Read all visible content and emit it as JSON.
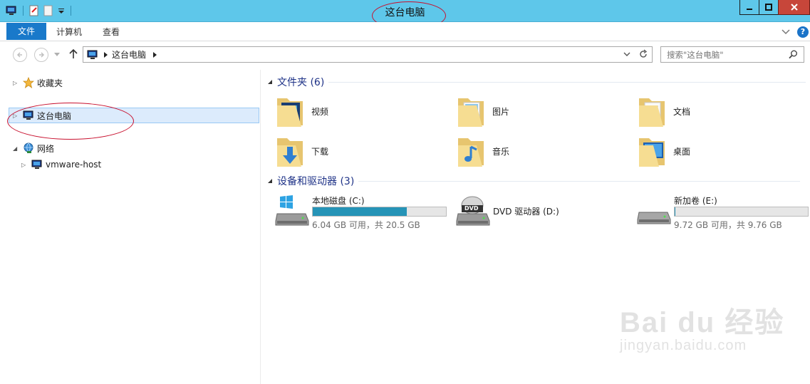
{
  "window": {
    "title": "这台电脑",
    "colors": {
      "titlebar": "#5ec7ea",
      "file_tab": "#1979ca",
      "close": "#c7463a",
      "annotation": "#c8102e"
    }
  },
  "ribbon": {
    "tabs": [
      {
        "label": "文件"
      },
      {
        "label": "计算机"
      },
      {
        "label": "查看"
      }
    ]
  },
  "address": {
    "crumb": "这台电脑",
    "search_placeholder": "搜索\"这台电脑\""
  },
  "nav": {
    "items": [
      {
        "label": "收藏夹",
        "icon": "star-icon"
      },
      {
        "label": "这台电脑",
        "icon": "computer-icon",
        "selected": true
      },
      {
        "label": "网络",
        "icon": "network-icon"
      },
      {
        "label": "vmware-host",
        "icon": "computer-icon"
      }
    ]
  },
  "folders": {
    "header": "文件夹 (6)",
    "items": [
      {
        "label": "视频",
        "icon": "videos-folder-icon"
      },
      {
        "label": "图片",
        "icon": "pictures-folder-icon"
      },
      {
        "label": "文档",
        "icon": "documents-folder-icon"
      },
      {
        "label": "下载",
        "icon": "downloads-folder-icon"
      },
      {
        "label": "音乐",
        "icon": "music-folder-icon"
      },
      {
        "label": "桌面",
        "icon": "desktop-folder-icon"
      }
    ]
  },
  "devices": {
    "header": "设备和驱动器 (3)",
    "items": [
      {
        "label": "本地磁盘 (C:)",
        "free_text": "6.04 GB 可用，共 20.5 GB",
        "used_fraction": 0.705
      },
      {
        "label": "DVD 驱动器 (D:)",
        "icon_text": "DVD"
      },
      {
        "label": "新加卷 (E:)",
        "free_text": "9.72 GB 可用，共 9.76 GB",
        "used_fraction": 0.004
      }
    ]
  },
  "watermark": {
    "main": "Bai du 经验",
    "sub": "jingyan.baidu.com"
  }
}
